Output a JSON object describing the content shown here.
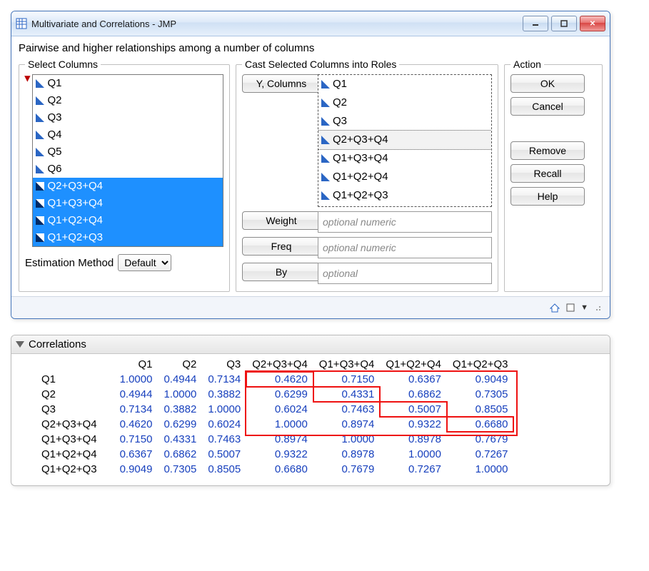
{
  "window": {
    "title": "Multivariate and Correlations - JMP",
    "subtitle": "Pairwise and higher relationships among a number of columns"
  },
  "select_columns": {
    "legend": "Select Columns",
    "items": [
      {
        "label": "Q1",
        "selected": false
      },
      {
        "label": "Q2",
        "selected": false
      },
      {
        "label": "Q3",
        "selected": false
      },
      {
        "label": "Q4",
        "selected": false
      },
      {
        "label": "Q5",
        "selected": false
      },
      {
        "label": "Q6",
        "selected": false
      },
      {
        "label": "Q2+Q3+Q4",
        "selected": true
      },
      {
        "label": "Q1+Q3+Q4",
        "selected": true
      },
      {
        "label": "Q1+Q2+Q4",
        "selected": true
      },
      {
        "label": "Q1+Q2+Q3",
        "selected": true
      }
    ]
  },
  "cast": {
    "legend": "Cast Selected Columns into Roles",
    "ycolumns_label": "Y, Columns",
    "ycolumns": [
      "Q1",
      "Q2",
      "Q3",
      "Q2+Q3+Q4",
      "Q1+Q3+Q4",
      "Q1+Q2+Q4",
      "Q1+Q2+Q3"
    ],
    "highlighted_index": 3,
    "weight_label": "Weight",
    "freq_label": "Freq",
    "by_label": "By",
    "weight_placeholder": "optional numeric",
    "freq_placeholder": "optional numeric",
    "by_placeholder": "optional"
  },
  "action": {
    "legend": "Action",
    "ok": "OK",
    "cancel": "Cancel",
    "remove": "Remove",
    "recall": "Recall",
    "help": "Help"
  },
  "estimation": {
    "label": "Estimation Method",
    "value": "Default"
  },
  "correlations": {
    "title": "Correlations",
    "headers": [
      "Q1",
      "Q2",
      "Q3",
      "Q2+Q3+Q4",
      "Q1+Q3+Q4",
      "Q1+Q2+Q4",
      "Q1+Q2+Q3"
    ],
    "rows": [
      {
        "name": "Q1",
        "values": [
          "1.0000",
          "0.4944",
          "0.7134",
          "0.4620",
          "0.7150",
          "0.6367",
          "0.9049"
        ]
      },
      {
        "name": "Q2",
        "values": [
          "0.4944",
          "1.0000",
          "0.3882",
          "0.6299",
          "0.4331",
          "0.6862",
          "0.7305"
        ]
      },
      {
        "name": "Q3",
        "values": [
          "0.7134",
          "0.3882",
          "1.0000",
          "0.6024",
          "0.7463",
          "0.5007",
          "0.8505"
        ]
      },
      {
        "name": "Q2+Q3+Q4",
        "values": [
          "0.4620",
          "0.6299",
          "0.6024",
          "1.0000",
          "0.8974",
          "0.9322",
          "0.6680"
        ]
      },
      {
        "name": "Q1+Q3+Q4",
        "values": [
          "0.7150",
          "0.4331",
          "0.7463",
          "0.8974",
          "1.0000",
          "0.8978",
          "0.7679"
        ]
      },
      {
        "name": "Q1+Q2+Q4",
        "values": [
          "0.6367",
          "0.6862",
          "0.5007",
          "0.9322",
          "0.8978",
          "1.0000",
          "0.7267"
        ]
      },
      {
        "name": "Q1+Q2+Q3",
        "values": [
          "0.9049",
          "0.7305",
          "0.8505",
          "0.6680",
          "0.7679",
          "0.7267",
          "1.0000"
        ]
      }
    ],
    "boxed_cells": [
      [
        0,
        3
      ],
      [
        1,
        4
      ],
      [
        2,
        5
      ],
      [
        3,
        6
      ]
    ],
    "big_box_rows": [
      0,
      3
    ],
    "big_box_cols": [
      3,
      6
    ]
  }
}
